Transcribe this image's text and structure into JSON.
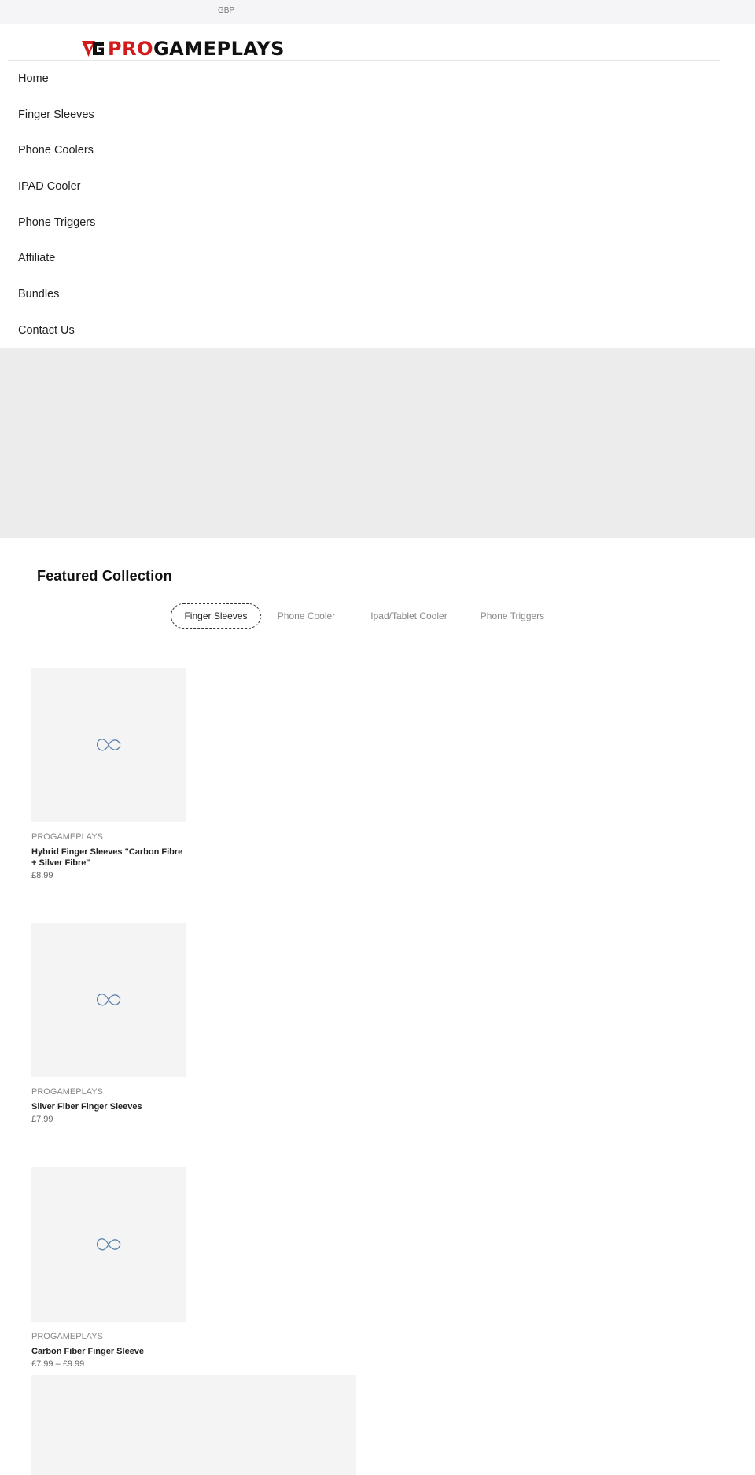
{
  "topbar": {
    "currency": "GBP"
  },
  "header": {
    "logo_pro": "PRO",
    "logo_rest": "GAMEPLAYS"
  },
  "nav": {
    "items": [
      {
        "label": "Home"
      },
      {
        "label": "Finger Sleeves"
      },
      {
        "label": "Phone Coolers"
      },
      {
        "label": "IPAD Cooler"
      },
      {
        "label": "Phone Triggers"
      },
      {
        "label": "Affiliate"
      },
      {
        "label": "Bundles"
      },
      {
        "label": "Contact Us"
      }
    ]
  },
  "featured": {
    "title": "Featured Collection",
    "tabs": [
      {
        "label": "Finger Sleeves",
        "active": true
      },
      {
        "label": "Phone Cooler",
        "active": false
      },
      {
        "label": "Ipad/Tablet Cooler",
        "active": false
      },
      {
        "label": "Phone Triggers",
        "active": false
      }
    ]
  },
  "products": [
    {
      "vendor": "PROGAMEPLAYS",
      "title": "Hybrid Finger Sleeves \"Carbon Fibre + Silver Fibre\"",
      "price": "£8.99",
      "image_icon": "placeholder-icon"
    },
    {
      "vendor": "PROGAMEPLAYS",
      "title": "Silver Fiber Finger Sleeves",
      "price": "£7.99",
      "image_icon": "placeholder-icon"
    },
    {
      "vendor": "PROGAMEPLAYS",
      "title": "Carbon Fiber Finger Sleeve",
      "price": "£7.99 – £9.99",
      "image_icon": "placeholder-icon"
    }
  ],
  "colors": {
    "brand_red": "#d21a1a",
    "placeholder_stroke": "#5a82ac",
    "hero_bg": "#ececec"
  }
}
